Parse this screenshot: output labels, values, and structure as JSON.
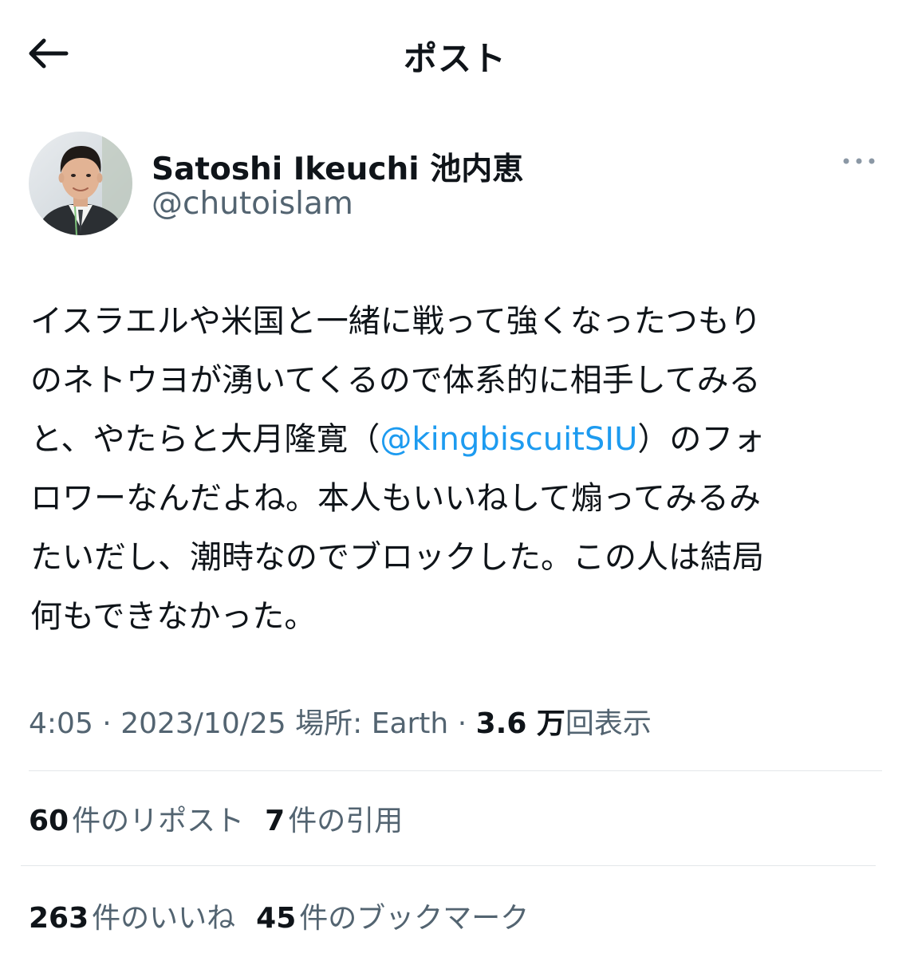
{
  "header": {
    "title": "ポスト",
    "back_icon": "arrow-left-icon"
  },
  "author": {
    "display_name": "Satoshi Ikeuchi 池内恵",
    "handle": "@chutoislam",
    "more_icon": "more-horizontal-icon"
  },
  "tweet": {
    "lines": [
      {
        "pre": "イスラエルや米国と一緒に戦って強くなったつもり"
      },
      {
        "pre": "のネトウヨが湧いてくるので体系的に相手してみる"
      },
      {
        "pre": "と、やたらと大月隆寛（",
        "mention": "@kingbiscuitSIU",
        "post": "）のフォ"
      },
      {
        "pre": "ロワーなんだよね。本人もいいねして煽ってみるみ"
      },
      {
        "pre": "たいだし、潮時なのでブロックした。この人は結局"
      },
      {
        "pre": "何もできなかった。"
      }
    ]
  },
  "meta": {
    "time": "4:05",
    "sep1": " · ",
    "date": "2023/10/25",
    "location": " 場所: Earth",
    "sep2": " · ",
    "views_count": "3.6 万",
    "views_label": "回表示"
  },
  "stats": {
    "reposts_count": "60",
    "reposts_label": "件のリポスト",
    "quotes_count": "7",
    "quotes_label": "件の引用",
    "likes_count": "263",
    "likes_label": "件のいいね",
    "bookmarks_count": "45",
    "bookmarks_label": "件のブックマーク"
  },
  "colors": {
    "link": "#1d9bf0",
    "secondary_text": "#536471",
    "primary_text": "#0f1419"
  }
}
